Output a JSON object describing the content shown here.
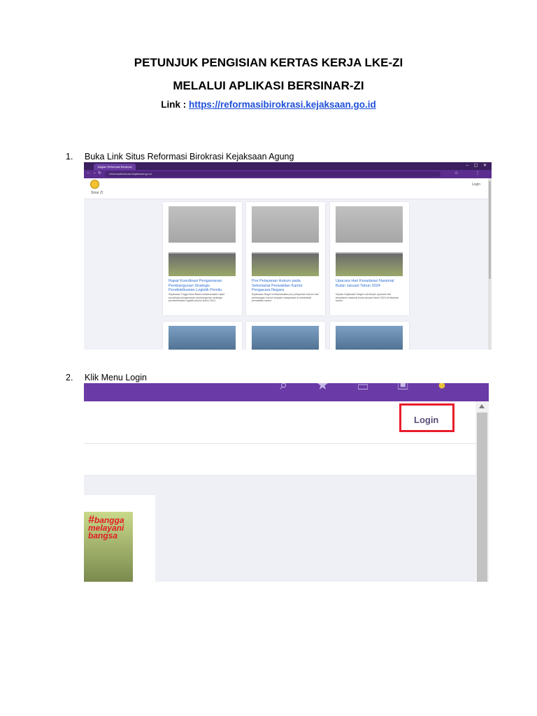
{
  "doc": {
    "title1": "PETUNJUK PENGISIAN KERTAS KERJA LKE-ZI",
    "title2": "MELALUI APLIKASI BERSINAR-ZI",
    "link_label": "Link : ",
    "link_url": "https://reformasibirokrasi.kejaksaan.go.id"
  },
  "steps": [
    {
      "num": "1.",
      "text": "Buka Link Situs Reformasi Birokrasi Kejaksaan Agung"
    },
    {
      "num": "2.",
      "text": "Klik Menu Login"
    }
  ],
  "screenshot1": {
    "tab": "Bagian Reformasi Birokrasi",
    "url": "reformasibirokrasi.kejaksaan.go.id",
    "brand": "Sinar ZI",
    "login": "Login",
    "cards": [
      {
        "title": "Rapat Koordinasi Pengamanan Pembangunan Strategis Pendistribusian Logistik Pemilu",
        "text": "Kejaksaan Tinggi Jawa Barat melaksanakan rapat koordinasi pengamanan pembangunan strategis pendistribusian logistik pemilu tahun 2024."
      },
      {
        "title": "Pos Pelayanan Hukum pada Sekretariat Perwakilan Kantor Pengacara Negara",
        "text": "Kejaksaan Negeri melaksanakan pos pelayanan hukum dan penerangan hukum kepada masyarakat di sekretariat perwakilan kantor."
      },
      {
        "title": "Upacara Hari Kesadaran Nasional Bulan Januari Tahun 2024",
        "text": "Kepala Kejaksaan Negeri memimpin upacara hari kesadaran nasional bulan januari tahun 2024 di halaman kantor."
      }
    ]
  },
  "screenshot2": {
    "login": "Login",
    "photo_text": [
      "#",
      "bangga",
      "melayani",
      "bangsa"
    ]
  }
}
